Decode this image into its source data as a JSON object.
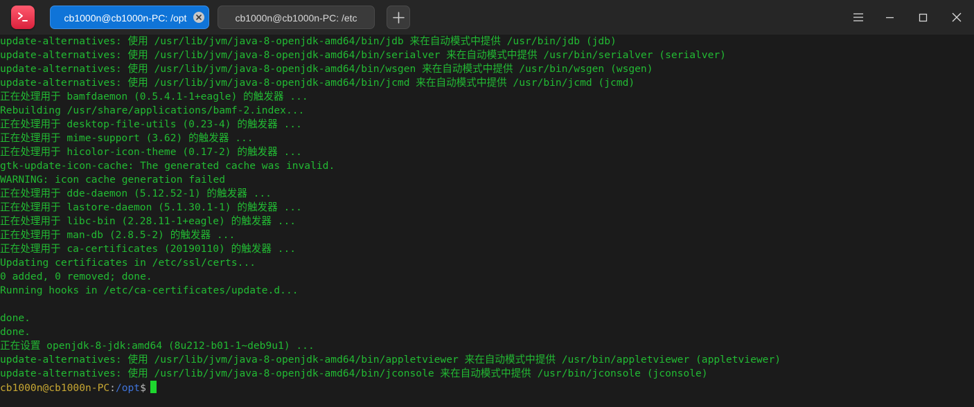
{
  "titlebar": {
    "tabs": [
      {
        "label": "cb1000n@cb1000n-PC: /opt",
        "active": true
      },
      {
        "label": "cb1000n@cb1000n-PC: /etc",
        "active": false
      }
    ],
    "icons": {
      "app": "terminal-app-icon",
      "tab_close": "close-circle-icon",
      "new_tab": "plus-icon",
      "menu": "hamburger-menu-icon",
      "minimize": "minimize-icon",
      "maximize": "maximize-icon",
      "close": "close-icon"
    }
  },
  "terminal": {
    "lines": [
      "update-alternatives: 使用 /usr/lib/jvm/java-8-openjdk-amd64/bin/jdb 来在自动模式中提供 /usr/bin/jdb (jdb)",
      "update-alternatives: 使用 /usr/lib/jvm/java-8-openjdk-amd64/bin/serialver 来在自动模式中提供 /usr/bin/serialver (serialver)",
      "update-alternatives: 使用 /usr/lib/jvm/java-8-openjdk-amd64/bin/wsgen 来在自动模式中提供 /usr/bin/wsgen (wsgen)",
      "update-alternatives: 使用 /usr/lib/jvm/java-8-openjdk-amd64/bin/jcmd 来在自动模式中提供 /usr/bin/jcmd (jcmd)",
      "正在处理用于 bamfdaemon (0.5.4.1-1+eagle) 的触发器 ...",
      "Rebuilding /usr/share/applications/bamf-2.index...",
      "正在处理用于 desktop-file-utils (0.23-4) 的触发器 ...",
      "正在处理用于 mime-support (3.62) 的触发器 ...",
      "正在处理用于 hicolor-icon-theme (0.17-2) 的触发器 ...",
      "gtk-update-icon-cache: The generated cache was invalid.",
      "WARNING: icon cache generation failed",
      "正在处理用于 dde-daemon (5.12.52-1) 的触发器 ...",
      "正在处理用于 lastore-daemon (5.1.30.1-1) 的触发器 ...",
      "正在处理用于 libc-bin (2.28.11-1+eagle) 的触发器 ...",
      "正在处理用于 man-db (2.8.5-2) 的触发器 ...",
      "正在处理用于 ca-certificates (20190110) 的触发器 ...",
      "Updating certificates in /etc/ssl/certs...",
      "0 added, 0 removed; done.",
      "Running hooks in /etc/ca-certificates/update.d...",
      "",
      "done.",
      "done.",
      "正在设置 openjdk-8-jdk:amd64 (8u212-b01-1~deb9u1) ...",
      "update-alternatives: 使用 /usr/lib/jvm/java-8-openjdk-amd64/bin/appletviewer 来在自动模式中提供 /usr/bin/appletviewer (appletviewer)",
      "update-alternatives: 使用 /usr/lib/jvm/java-8-openjdk-amd64/bin/jconsole 来在自动模式中提供 /usr/bin/jconsole (jconsole)"
    ],
    "prompt": {
      "user_host": "cb1000n@cb1000n-PC",
      "colon": ":",
      "path": "/opt",
      "symbol": "$"
    }
  },
  "colors": {
    "output_text": "#22bb33",
    "prompt_user": "#c8a833",
    "prompt_path": "#3f73d9",
    "cursor": "#1ed72e",
    "background": "#1b1b1b",
    "active_tab": "#0f74d8"
  }
}
